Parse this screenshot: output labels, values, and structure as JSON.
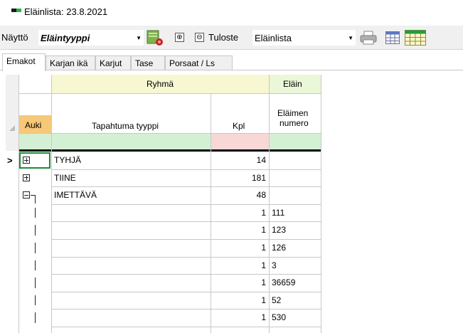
{
  "window": {
    "title": "Eläinlista: 23.8.2021"
  },
  "toolbar": {
    "view_label": "Näyttö",
    "view_value": "Eläintyyppi",
    "expand_symbol": "⊕",
    "collapse_symbol": "⊖",
    "print_label": "Tuloste",
    "print_value": "Eläinlista",
    "icons": [
      "settings-gear-icon",
      "printer-icon",
      "grid-view-icon",
      "calendar-icon"
    ]
  },
  "tabs": [
    "Emakot",
    "Karjan ikä",
    "Karjut",
    "Tase",
    "Porsaat / Ls"
  ],
  "active_tab": "Emakot",
  "grid": {
    "groups": {
      "ryhma": "Ryhmä",
      "elain": "Eläin"
    },
    "headers": {
      "auki": "Auki",
      "tapahtuma": "Tapahtuma tyyppi",
      "kpl": "Kpl",
      "elaimen_numero_1": "Eläimen",
      "elaimen_numero_2": "numero"
    },
    "row_indicator": ">",
    "group_rows": [
      {
        "type": "TYHJÄ",
        "kpl": "14"
      },
      {
        "type": "TIINE",
        "kpl": "181"
      },
      {
        "type": "IMETTÄVÄ",
        "kpl": "48"
      }
    ],
    "detail_rows": [
      {
        "kpl": "1",
        "numero": "111"
      },
      {
        "kpl": "1",
        "numero": "123"
      },
      {
        "kpl": "1",
        "numero": "126"
      },
      {
        "kpl": "1",
        "numero": "3"
      },
      {
        "kpl": "1",
        "numero": "36659"
      },
      {
        "kpl": "1",
        "numero": "52"
      },
      {
        "kpl": "1",
        "numero": "530"
      }
    ],
    "colors": {
      "ryhma_bg": "#f7f7d2",
      "elain_bg": "#eaf7d8",
      "auki_bg": "#f7c878",
      "header_bg": "#ffffff",
      "filter_green": "#d4f0d4",
      "filter_pink": "#f8d7d7"
    }
  }
}
